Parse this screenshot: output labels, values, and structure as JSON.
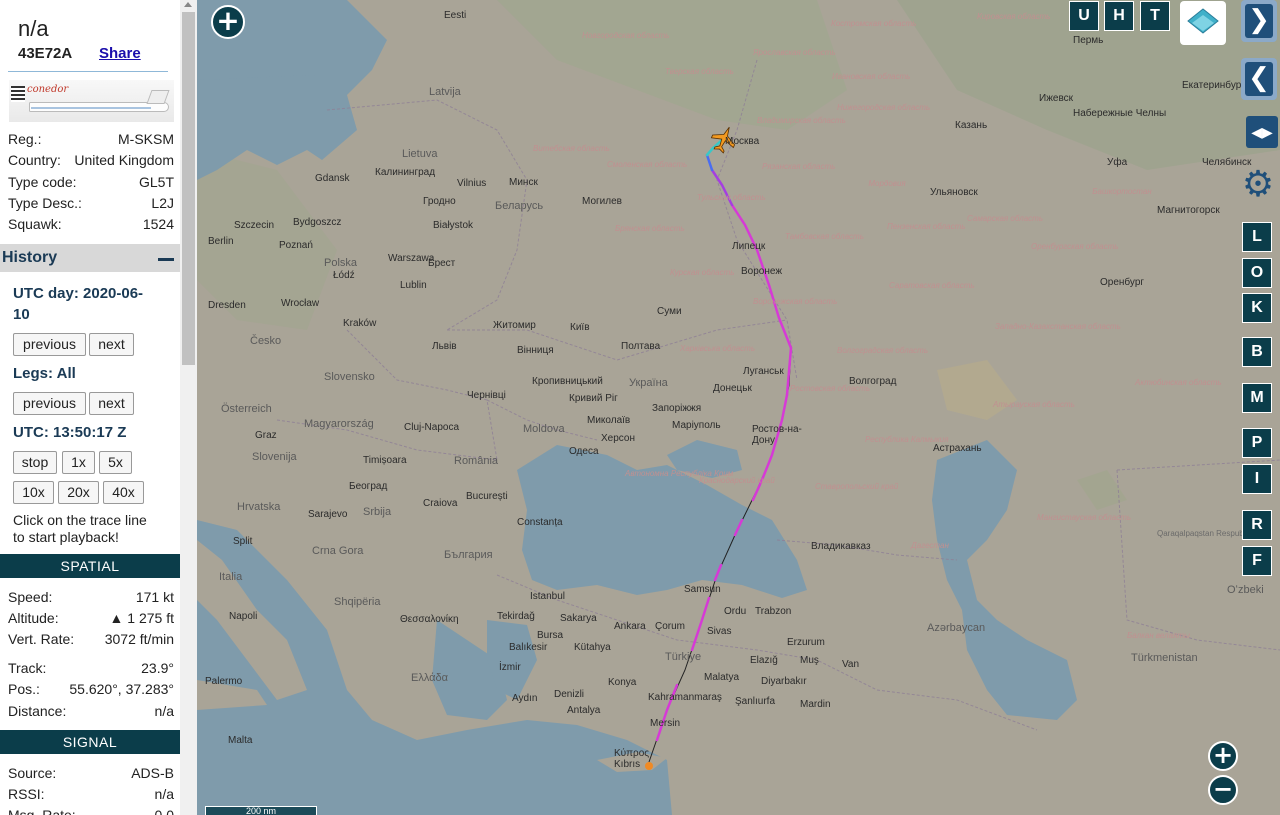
{
  "aircraft": {
    "callsign": "n/a",
    "icao": "43E72A",
    "share_label": "Share",
    "photo_logo_text": "conedor"
  },
  "details": [
    {
      "key": "Reg.:",
      "value": "M-SKSM"
    },
    {
      "key": "Country:",
      "value": "United Kingdom"
    },
    {
      "key": "Type code:",
      "value": "GL5T"
    },
    {
      "key": "Type Desc.:",
      "value": "L2J"
    },
    {
      "key": "Squawk:",
      "value": "1524"
    }
  ],
  "history": {
    "title": "History",
    "utc_day_line1": "UTC day: 2020-06-",
    "utc_day_line2": "10",
    "day_prev": "previous",
    "day_next": "next",
    "legs": "Legs: All",
    "legs_prev": "previous",
    "legs_next": "next",
    "utc_time": "UTC: 13:50:17 Z",
    "speed_buttons": [
      "stop",
      "1x",
      "5x",
      "10x",
      "20x",
      "40x"
    ],
    "hint_line1": "Click on the trace line",
    "hint_line2": "to start playback!"
  },
  "spatial": {
    "title": "SPATIAL",
    "rows": [
      {
        "key": "Speed:",
        "value": "171 kt"
      },
      {
        "key": "Altitude:",
        "value": "▲ 1 275 ft"
      },
      {
        "key": "Vert. Rate:",
        "value": "3072 ft/min"
      },
      {
        "key": "Track:",
        "value": "23.9°"
      },
      {
        "key": "Pos.:",
        "value": "55.620°, 37.283°"
      },
      {
        "key": "Distance:",
        "value": "n/a"
      }
    ]
  },
  "signal": {
    "title": "SIGNAL",
    "rows": [
      {
        "key": "Source:",
        "value": "ADS-B"
      },
      {
        "key": "RSSI:",
        "value": "n/a"
      },
      {
        "key": "Msg. Rate:",
        "value": "0.0"
      }
    ]
  },
  "map": {
    "scale_label": "200 nm",
    "top_buttons": [
      "U",
      "H",
      "T"
    ],
    "side_buttons": [
      "L",
      "O",
      "K",
      "B",
      "M",
      "P",
      "I",
      "R",
      "F"
    ],
    "zoom_in": "+",
    "zoom_out": "−",
    "next_arrow": "❯",
    "prev_arrow": "❮",
    "lr_symbol": "◀▶",
    "gear_symbol": "⚙",
    "countries": [
      {
        "name": "Latvija"
      },
      {
        "name": "Lietuva"
      },
      {
        "name": "Беларусь"
      },
      {
        "name": "Polska"
      },
      {
        "name": "Україна"
      },
      {
        "name": "Česko"
      },
      {
        "name": "Slovensko"
      },
      {
        "name": "Österreich"
      },
      {
        "name": "Magyarország"
      },
      {
        "name": "România"
      },
      {
        "name": "Moldova"
      },
      {
        "name": "Hrvatska"
      },
      {
        "name": "Srbija"
      },
      {
        "name": "България"
      },
      {
        "name": "Crna Gora"
      },
      {
        "name": "Shqipëria"
      },
      {
        "name": "Ελλάδα"
      },
      {
        "name": "Türkiye"
      },
      {
        "name": "Italia"
      },
      {
        "name": "Azərbaycan"
      },
      {
        "name": "Türkmenistan"
      },
      {
        "name": "Slovenija"
      },
      {
        "name": "Qaraqalpaqstan Respublikası"
      },
      {
        "name": "Oʻzbeki"
      }
    ],
    "cities": [
      {
        "name": "Eesti"
      },
      {
        "name": "Пермь"
      },
      {
        "name": "Ижевск"
      },
      {
        "name": "Набережные Челны"
      },
      {
        "name": "Казань"
      },
      {
        "name": "Екатеринбург"
      },
      {
        "name": "Уфа"
      },
      {
        "name": "Челябинск"
      },
      {
        "name": "Ульяновск"
      },
      {
        "name": "Магнитогорск"
      },
      {
        "name": "Москва"
      },
      {
        "name": "Gdansk"
      },
      {
        "name": "Калининград"
      },
      {
        "name": "Vilnius"
      },
      {
        "name": "Минск"
      },
      {
        "name": "Гродно"
      },
      {
        "name": "Могилев"
      },
      {
        "name": "Bydgoszcz"
      },
      {
        "name": "Szczecin"
      },
      {
        "name": "Białystok"
      },
      {
        "name": "Berlin"
      },
      {
        "name": "Poznań"
      },
      {
        "name": "Warszawa"
      },
      {
        "name": "Брест"
      },
      {
        "name": "Липецк"
      },
      {
        "name": "Воронеж"
      },
      {
        "name": "Оренбург"
      },
      {
        "name": "Łódź"
      },
      {
        "name": "Lublin"
      },
      {
        "name": "Dresden"
      },
      {
        "name": "Wrocław"
      },
      {
        "name": "Kraków"
      },
      {
        "name": "Житомир"
      },
      {
        "name": "Київ"
      },
      {
        "name": "Суми"
      },
      {
        "name": "Полтава"
      },
      {
        "name": "Львів"
      },
      {
        "name": "Вінниця"
      },
      {
        "name": "Кропивницький"
      },
      {
        "name": "Луганськ"
      },
      {
        "name": "Волгоград"
      },
      {
        "name": "Донецьк"
      },
      {
        "name": "Чернівці"
      },
      {
        "name": "Кривий Ріг"
      },
      {
        "name": "Запоріжжя"
      },
      {
        "name": "Миколаїв"
      },
      {
        "name": "Маріуполь"
      },
      {
        "name": "Ростов-на-Дону"
      },
      {
        "name": "Херсон"
      },
      {
        "name": "Одеса"
      },
      {
        "name": "Cluj-Napoca"
      },
      {
        "name": "Graz"
      },
      {
        "name": "Астрахань"
      },
      {
        "name": "Timișoara"
      },
      {
        "name": "Београд"
      },
      {
        "name": "Craiova"
      },
      {
        "name": "București"
      },
      {
        "name": "Constanța"
      },
      {
        "name": "Sarajevo"
      },
      {
        "name": "Split"
      },
      {
        "name": "Владикавказ"
      },
      {
        "name": "Istanbul"
      },
      {
        "name": "Samsun"
      },
      {
        "name": "Ordu"
      },
      {
        "name": "Trabzon"
      },
      {
        "name": "Tekirdağ"
      },
      {
        "name": "Sakarya"
      },
      {
        "name": "Ankara"
      },
      {
        "name": "Çorum"
      },
      {
        "name": "Sivas"
      },
      {
        "name": "Erzurum"
      },
      {
        "name": "Bursa"
      },
      {
        "name": "Balıkesir"
      },
      {
        "name": "Kütahya"
      },
      {
        "name": "Elazığ"
      },
      {
        "name": "Muş"
      },
      {
        "name": "Van"
      },
      {
        "name": "Napoli"
      },
      {
        "name": "Θεσσαλονίκη"
      },
      {
        "name": "İzmir"
      },
      {
        "name": "Konya"
      },
      {
        "name": "Malatya"
      },
      {
        "name": "Diyarbakır"
      },
      {
        "name": "Kahramanmaraş"
      },
      {
        "name": "Şanlıurfa"
      },
      {
        "name": "Mardin"
      },
      {
        "name": "Aydın"
      },
      {
        "name": "Denizli"
      },
      {
        "name": "Antalya"
      },
      {
        "name": "Palermo"
      },
      {
        "name": "Mersin"
      },
      {
        "name": "Malta"
      },
      {
        "name": "Κύπρος Kıbrıs"
      }
    ],
    "regions": [
      {
        "name": "Костромская область"
      },
      {
        "name": "Кировская область"
      },
      {
        "name": "Новгородская область"
      },
      {
        "name": "Тверская область"
      },
      {
        "name": "Ярославская область"
      },
      {
        "name": "Ивановская область"
      },
      {
        "name": "Нижегородская область"
      },
      {
        "name": "Владимирская область"
      },
      {
        "name": "Витебская область"
      },
      {
        "name": "Смоленская область"
      },
      {
        "name": "Рязанская область"
      },
      {
        "name": "Тульская область"
      },
      {
        "name": "Брянская область"
      },
      {
        "name": "Тамбовская область"
      },
      {
        "name": "Пензенская область"
      },
      {
        "name": "Самарская область"
      },
      {
        "name": "Курская область"
      },
      {
        "name": "Воронежская область"
      },
      {
        "name": "Саратовская область"
      },
      {
        "name": "Харківська область"
      },
      {
        "name": "Волгоградская область"
      },
      {
        "name": "Ростовская область"
      },
      {
        "name": "Республика Калмыкия"
      },
      {
        "name": "Ставропольский край"
      },
      {
        "name": "Краснодарский край"
      },
      {
        "name": "Автономна Республіка Крим"
      },
      {
        "name": "Мангистауская область"
      },
      {
        "name": "Атырауская область"
      },
      {
        "name": "Западно-Казахстанская область"
      },
      {
        "name": "Актюбинская область"
      },
      {
        "name": "Оренбургская область"
      },
      {
        "name": "Башкортостан"
      },
      {
        "name": "Мордовия"
      },
      {
        "name": "Дагестан"
      },
      {
        "name": "Балкан велаяты"
      }
    ]
  }
}
